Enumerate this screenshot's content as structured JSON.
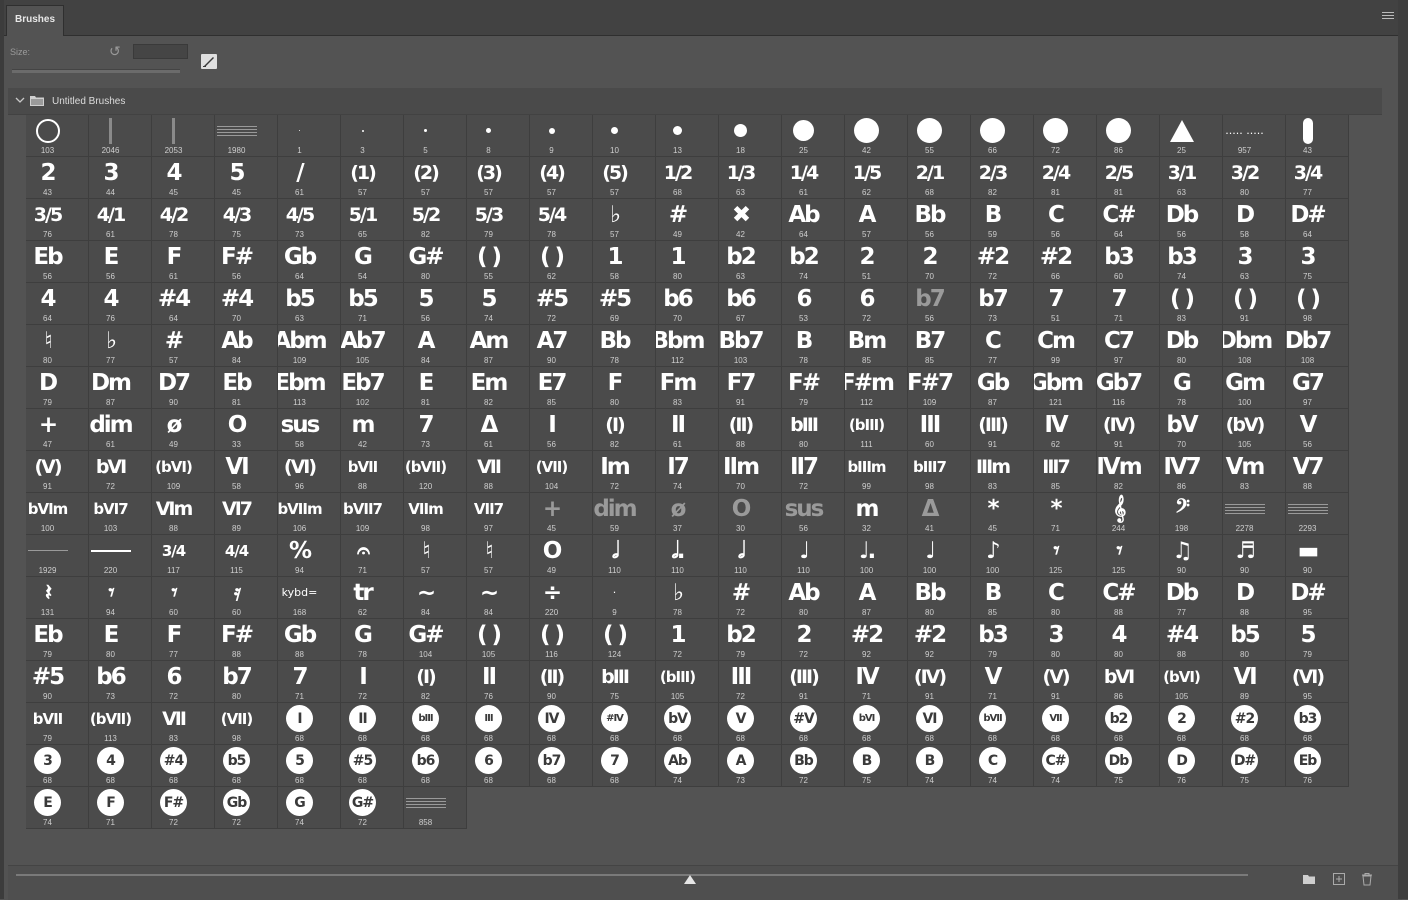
{
  "panel": {
    "tab_label": "Brushes",
    "size_label": "Size:",
    "size_value": "",
    "group_name": "Untitled Brushes"
  },
  "icons": {
    "panel_menu": "hamburger-menu-icon",
    "reset": "reset-icon",
    "brush_settings": "brush-settings-icon",
    "chevron": "chevron-down-icon",
    "folder": "folder-icon",
    "new_group": "folder-icon",
    "new_brush": "add-icon",
    "delete": "trash-icon"
  },
  "brushes": [
    {
      "g": "",
      "n": "103",
      "k": "ring"
    },
    {
      "g": "",
      "n": "2046",
      "k": "line"
    },
    {
      "g": "",
      "n": "2053",
      "k": "line"
    },
    {
      "g": "",
      "n": "1980",
      "k": "hatch"
    },
    {
      "g": "",
      "n": "1",
      "k": "dot1"
    },
    {
      "g": "",
      "n": "3",
      "k": "dot2"
    },
    {
      "g": "",
      "n": "5",
      "k": "dot3"
    },
    {
      "g": "",
      "n": "8",
      "k": "dot4"
    },
    {
      "g": "",
      "n": "9",
      "k": "dot5"
    },
    {
      "g": "",
      "n": "10",
      "k": "dot6"
    },
    {
      "g": "",
      "n": "13",
      "k": "dot7"
    },
    {
      "g": "",
      "n": "18",
      "k": "dot8"
    },
    {
      "g": "",
      "n": "25",
      "k": "dot9"
    },
    {
      "g": "",
      "n": "42",
      "k": "dot10"
    },
    {
      "g": "",
      "n": "55",
      "k": "dot10"
    },
    {
      "g": "",
      "n": "66",
      "k": "dot10"
    },
    {
      "g": "",
      "n": "72",
      "k": "dot10"
    },
    {
      "g": "",
      "n": "86",
      "k": "dot10"
    },
    {
      "g": "",
      "n": "25",
      "k": "tri"
    },
    {
      "g": "..... .....",
      "n": "957",
      "k": "tiny"
    },
    {
      "g": "",
      "n": "43",
      "k": "pill"
    },
    {
      "g": "2",
      "n": "43"
    },
    {
      "g": "3",
      "n": "44"
    },
    {
      "g": "4",
      "n": "45"
    },
    {
      "g": "5",
      "n": "45"
    },
    {
      "g": "/",
      "n": "61"
    },
    {
      "g": "(1)",
      "n": "57",
      "k": "med"
    },
    {
      "g": "(2)",
      "n": "57",
      "k": "med"
    },
    {
      "g": "(3)",
      "n": "57",
      "k": "med"
    },
    {
      "g": "(4)",
      "n": "57",
      "k": "med"
    },
    {
      "g": "(5)",
      "n": "57",
      "k": "med"
    },
    {
      "g": "1/2",
      "n": "68",
      "k": "med"
    },
    {
      "g": "1/3",
      "n": "63",
      "k": "med"
    },
    {
      "g": "1/4",
      "n": "61",
      "k": "med"
    },
    {
      "g": "1/5",
      "n": "62",
      "k": "med"
    },
    {
      "g": "2/1",
      "n": "68",
      "k": "med"
    },
    {
      "g": "2/3",
      "n": "82",
      "k": "med"
    },
    {
      "g": "2/4",
      "n": "81",
      "k": "med"
    },
    {
      "g": "2/5",
      "n": "81",
      "k": "med"
    },
    {
      "g": "3/1",
      "n": "63",
      "k": "med"
    },
    {
      "g": "3/2",
      "n": "80",
      "k": "med"
    },
    {
      "g": "3/4",
      "n": "77",
      "k": "med"
    },
    {
      "g": "3/5",
      "n": "76",
      "k": "med"
    },
    {
      "g": "4/1",
      "n": "61",
      "k": "med"
    },
    {
      "g": "4/2",
      "n": "78",
      "k": "med"
    },
    {
      "g": "4/3",
      "n": "75",
      "k": "med"
    },
    {
      "g": "4/5",
      "n": "73",
      "k": "med"
    },
    {
      "g": "5/1",
      "n": "65",
      "k": "med"
    },
    {
      "g": "5/2",
      "n": "82",
      "k": "med"
    },
    {
      "g": "5/3",
      "n": "79",
      "k": "med"
    },
    {
      "g": "5/4",
      "n": "78",
      "k": "med"
    },
    {
      "g": "♭",
      "n": "57"
    },
    {
      "g": "#",
      "n": "49"
    },
    {
      "g": "✖",
      "n": "42"
    },
    {
      "g": "Ab",
      "n": "64"
    },
    {
      "g": "A",
      "n": "57"
    },
    {
      "g": "Bb",
      "n": "56"
    },
    {
      "g": "B",
      "n": "59"
    },
    {
      "g": "C",
      "n": "56"
    },
    {
      "g": "C#",
      "n": "64"
    },
    {
      "g": "Db",
      "n": "56"
    },
    {
      "g": "D",
      "n": "58"
    },
    {
      "g": "D#",
      "n": "64"
    },
    {
      "g": "Eb",
      "n": "56"
    },
    {
      "g": "E",
      "n": "56"
    },
    {
      "g": "F",
      "n": "61"
    },
    {
      "g": "F#",
      "n": "56"
    },
    {
      "g": "Gb",
      "n": "64"
    },
    {
      "g": "G",
      "n": "54"
    },
    {
      "g": "G#",
      "n": "80"
    },
    {
      "g": "( )",
      "n": "55"
    },
    {
      "g": "( )",
      "n": "62"
    },
    {
      "g": "1",
      "n": "58"
    },
    {
      "g": "1",
      "n": "80"
    },
    {
      "g": "b2",
      "n": "63"
    },
    {
      "g": "b2",
      "n": "74"
    },
    {
      "g": "2",
      "n": "51"
    },
    {
      "g": "2",
      "n": "70"
    },
    {
      "g": "#2",
      "n": "72"
    },
    {
      "g": "#2",
      "n": "66"
    },
    {
      "g": "b3",
      "n": "60"
    },
    {
      "g": "b3",
      "n": "74"
    },
    {
      "g": "3",
      "n": "63"
    },
    {
      "g": "3",
      "n": "75"
    },
    {
      "g": "4",
      "n": "64"
    },
    {
      "g": "4",
      "n": "76"
    },
    {
      "g": "#4",
      "n": "64"
    },
    {
      "g": "#4",
      "n": "70"
    },
    {
      "g": "b5",
      "n": "63"
    },
    {
      "g": "b5",
      "n": "71"
    },
    {
      "g": "5",
      "n": "56"
    },
    {
      "g": "5",
      "n": "74"
    },
    {
      "g": "#5",
      "n": "72"
    },
    {
      "g": "#5",
      "n": "69"
    },
    {
      "g": "b6",
      "n": "70"
    },
    {
      "g": "b6",
      "n": "67"
    },
    {
      "g": "6",
      "n": "53"
    },
    {
      "g": "6",
      "n": "72"
    },
    {
      "g": "b7",
      "n": "56",
      "k": "gray"
    },
    {
      "g": "b7",
      "n": "73"
    },
    {
      "g": "7",
      "n": "51"
    },
    {
      "g": "7",
      "n": "71"
    },
    {
      "g": "( )",
      "n": "83"
    },
    {
      "g": "( )",
      "n": "91"
    },
    {
      "g": "( )",
      "n": "98"
    },
    {
      "g": "♮",
      "n": "80"
    },
    {
      "g": "♭",
      "n": "77"
    },
    {
      "g": "#",
      "n": "57"
    },
    {
      "g": "Ab",
      "n": "84"
    },
    {
      "g": "Abm",
      "n": "109"
    },
    {
      "g": "Ab7",
      "n": "105"
    },
    {
      "g": "A",
      "n": "84"
    },
    {
      "g": "Am",
      "n": "87"
    },
    {
      "g": "A7",
      "n": "90"
    },
    {
      "g": "Bb",
      "n": "78"
    },
    {
      "g": "Bbm",
      "n": "112"
    },
    {
      "g": "Bb7",
      "n": "103"
    },
    {
      "g": "B",
      "n": "78"
    },
    {
      "g": "Bm",
      "n": "85"
    },
    {
      "g": "B7",
      "n": "85"
    },
    {
      "g": "C",
      "n": "77"
    },
    {
      "g": "Cm",
      "n": "99"
    },
    {
      "g": "C7",
      "n": "97"
    },
    {
      "g": "Db",
      "n": "80"
    },
    {
      "g": "Dbm",
      "n": "108"
    },
    {
      "g": "Db7",
      "n": "108"
    },
    {
      "g": "D",
      "n": "79"
    },
    {
      "g": "Dm",
      "n": "87"
    },
    {
      "g": "D7",
      "n": "90"
    },
    {
      "g": "Eb",
      "n": "81"
    },
    {
      "g": "Ebm",
      "n": "113"
    },
    {
      "g": "Eb7",
      "n": "102"
    },
    {
      "g": "E",
      "n": "81"
    },
    {
      "g": "Em",
      "n": "82"
    },
    {
      "g": "E7",
      "n": "85"
    },
    {
      "g": "F",
      "n": "80"
    },
    {
      "g": "Fm",
      "n": "83"
    },
    {
      "g": "F7",
      "n": "91"
    },
    {
      "g": "F#",
      "n": "79"
    },
    {
      "g": "F#m",
      "n": "112"
    },
    {
      "g": "F#7",
      "n": "109"
    },
    {
      "g": "Gb",
      "n": "87"
    },
    {
      "g": "Gbm",
      "n": "121"
    },
    {
      "g": "Gb7",
      "n": "116"
    },
    {
      "g": "G",
      "n": "78"
    },
    {
      "g": "Gm",
      "n": "100"
    },
    {
      "g": "G7",
      "n": "97"
    },
    {
      "g": "+",
      "n": "47"
    },
    {
      "g": "dim",
      "n": "61"
    },
    {
      "g": "ø",
      "n": "49"
    },
    {
      "g": "O",
      "n": "33"
    },
    {
      "g": "sus",
      "n": "58"
    },
    {
      "g": "m",
      "n": "42"
    },
    {
      "g": "7",
      "n": "73"
    },
    {
      "g": "Δ",
      "n": "61"
    },
    {
      "g": "I",
      "n": "56"
    },
    {
      "g": "(I)",
      "n": "82",
      "k": "med"
    },
    {
      "g": "II",
      "n": "61"
    },
    {
      "g": "(II)",
      "n": "88",
      "k": "med"
    },
    {
      "g": "bIII",
      "n": "80",
      "k": "med"
    },
    {
      "g": "(bIII)",
      "n": "111",
      "k": "small"
    },
    {
      "g": "III",
      "n": "60"
    },
    {
      "g": "(III)",
      "n": "91",
      "k": "med"
    },
    {
      "g": "IV",
      "n": "62"
    },
    {
      "g": "(IV)",
      "n": "91",
      "k": "med"
    },
    {
      "g": "bV",
      "n": "70"
    },
    {
      "g": "(bV)",
      "n": "105",
      "k": "med"
    },
    {
      "g": "V",
      "n": "56"
    },
    {
      "g": "(V)",
      "n": "91",
      "k": "med"
    },
    {
      "g": "bVI",
      "n": "72",
      "k": "med"
    },
    {
      "g": "(bVI)",
      "n": "109",
      "k": "small"
    },
    {
      "g": "VI",
      "n": "58"
    },
    {
      "g": "(VI)",
      "n": "96",
      "k": "med"
    },
    {
      "g": "bVII",
      "n": "88",
      "k": "small"
    },
    {
      "g": "(bVII)",
      "n": "120",
      "k": "small"
    },
    {
      "g": "VII",
      "n": "88",
      "k": "med"
    },
    {
      "g": "(VII)",
      "n": "104",
      "k": "small"
    },
    {
      "g": "Im",
      "n": "72"
    },
    {
      "g": "I7",
      "n": "74"
    },
    {
      "g": "IIm",
      "n": "70"
    },
    {
      "g": "II7",
      "n": "72"
    },
    {
      "g": "bIIIm",
      "n": "99",
      "k": "small"
    },
    {
      "g": "bIII7",
      "n": "98",
      "k": "small"
    },
    {
      "g": "IIIm",
      "n": "83",
      "k": "med"
    },
    {
      "g": "III7",
      "n": "85",
      "k": "med"
    },
    {
      "g": "IVm",
      "n": "82"
    },
    {
      "g": "IV7",
      "n": "86"
    },
    {
      "g": "Vm",
      "n": "83"
    },
    {
      "g": "V7",
      "n": "88"
    },
    {
      "g": "bVIm",
      "n": "100",
      "k": "small"
    },
    {
      "g": "bVI7",
      "n": "103",
      "k": "small"
    },
    {
      "g": "VIm",
      "n": "88",
      "k": "med"
    },
    {
      "g": "VI7",
      "n": "89",
      "k": "med"
    },
    {
      "g": "bVIIm",
      "n": "106",
      "k": "small"
    },
    {
      "g": "bVII7",
      "n": "109",
      "k": "small"
    },
    {
      "g": "VIIm",
      "n": "98",
      "k": "small"
    },
    {
      "g": "VII7",
      "n": "97",
      "k": "small"
    },
    {
      "g": "+",
      "n": "45",
      "k": "gray"
    },
    {
      "g": "dim",
      "n": "59",
      "k": "gray"
    },
    {
      "g": "ø",
      "n": "37",
      "k": "gray"
    },
    {
      "g": "O",
      "n": "30",
      "k": "gray"
    },
    {
      "g": "sus",
      "n": "56",
      "k": "gray"
    },
    {
      "g": "m",
      "n": "32"
    },
    {
      "g": "Δ",
      "n": "41",
      "k": "gray"
    },
    {
      "g": "*",
      "n": "45"
    },
    {
      "g": "*",
      "n": "71"
    },
    {
      "g": "𝄞",
      "n": "244"
    },
    {
      "g": "𝄢",
      "n": "198"
    },
    {
      "g": "",
      "n": "2278",
      "k": "hatch"
    },
    {
      "g": "",
      "n": "2293",
      "k": "hatch"
    },
    {
      "g": "",
      "n": "1929",
      "k": "line"
    },
    {
      "g": "",
      "n": "220",
      "k": "line"
    },
    {
      "g": "3/4",
      "n": "117",
      "k": "small"
    },
    {
      "g": "4/4",
      "n": "115",
      "k": "small"
    },
    {
      "g": "%",
      "n": "94"
    },
    {
      "g": "𝄐",
      "n": "71"
    },
    {
      "g": "♮",
      "n": "57"
    },
    {
      "g": "♮",
      "n": "57"
    },
    {
      "g": "O",
      "n": "49"
    },
    {
      "g": "𝅗𝅥",
      "n": "110"
    },
    {
      "g": "𝅗𝅥.",
      "n": "110"
    },
    {
      "g": "𝅗𝅥",
      "n": "110"
    },
    {
      "g": "♩",
      "n": "110"
    },
    {
      "g": "♩.",
      "n": "100"
    },
    {
      "g": "♩",
      "n": "100"
    },
    {
      "g": "♪",
      "n": "100"
    },
    {
      "g": "𝄾",
      "n": "125"
    },
    {
      "g": "𝄾",
      "n": "125"
    },
    {
      "g": "♫",
      "n": "90"
    },
    {
      "g": "♬",
      "n": "90"
    },
    {
      "g": "▬",
      "n": "90"
    },
    {
      "g": "𝄽",
      "n": "131"
    },
    {
      "g": "𝄾",
      "n": "94"
    },
    {
      "g": "𝄾",
      "n": "60"
    },
    {
      "g": "𝄿",
      "n": "60"
    },
    {
      "g": "kybd=",
      "n": "168",
      "k": "tiny"
    },
    {
      "g": "tr",
      "n": "62"
    },
    {
      "g": "~",
      "n": "84"
    },
    {
      "g": "~",
      "n": "84"
    },
    {
      "g": "÷",
      "n": "220"
    },
    {
      "g": "·",
      "n": "9",
      "k": "tiny"
    },
    {
      "g": "♭",
      "n": "78"
    },
    {
      "g": "#",
      "n": "72"
    },
    {
      "g": "Ab",
      "n": "80"
    },
    {
      "g": "A",
      "n": "87"
    },
    {
      "g": "Bb",
      "n": "80"
    },
    {
      "g": "B",
      "n": "85"
    },
    {
      "g": "C",
      "n": "80"
    },
    {
      "g": "C#",
      "n": "88"
    },
    {
      "g": "Db",
      "n": "77"
    },
    {
      "g": "D",
      "n": "88"
    },
    {
      "g": "D#",
      "n": "95"
    },
    {
      "g": "Eb",
      "n": "79"
    },
    {
      "g": "E",
      "n": "80"
    },
    {
      "g": "F",
      "n": "77"
    },
    {
      "g": "F#",
      "n": "88"
    },
    {
      "g": "Gb",
      "n": "88"
    },
    {
      "g": "G",
      "n": "78"
    },
    {
      "g": "G#",
      "n": "104"
    },
    {
      "g": "( )",
      "n": "105"
    },
    {
      "g": "( )",
      "n": "116"
    },
    {
      "g": "( )",
      "n": "124"
    },
    {
      "g": "1",
      "n": "72"
    },
    {
      "g": "b2",
      "n": "79"
    },
    {
      "g": "2",
      "n": "72"
    },
    {
      "g": "#2",
      "n": "92"
    },
    {
      "g": "#2",
      "n": "92"
    },
    {
      "g": "b3",
      "n": "79"
    },
    {
      "g": "3",
      "n": "80"
    },
    {
      "g": "4",
      "n": "80"
    },
    {
      "g": "#4",
      "n": "88"
    },
    {
      "g": "b5",
      "n": "80"
    },
    {
      "g": "5",
      "n": "79"
    },
    {
      "g": "#5",
      "n": "90"
    },
    {
      "g": "b6",
      "n": "73"
    },
    {
      "g": "6",
      "n": "72"
    },
    {
      "g": "b7",
      "n": "80"
    },
    {
      "g": "7",
      "n": "71"
    },
    {
      "g": "I",
      "n": "72"
    },
    {
      "g": "(I)",
      "n": "82",
      "k": "med"
    },
    {
      "g": "II",
      "n": "76"
    },
    {
      "g": "(II)",
      "n": "90",
      "k": "med"
    },
    {
      "g": "bIII",
      "n": "75",
      "k": "med"
    },
    {
      "g": "(bIII)",
      "n": "105",
      "k": "small"
    },
    {
      "g": "III",
      "n": "72"
    },
    {
      "g": "(III)",
      "n": "91",
      "k": "med"
    },
    {
      "g": "IV",
      "n": "71"
    },
    {
      "g": "(IV)",
      "n": "91",
      "k": "med"
    },
    {
      "g": "V",
      "n": "71"
    },
    {
      "g": "(V)",
      "n": "91",
      "k": "med"
    },
    {
      "g": "bVI",
      "n": "86",
      "k": "med"
    },
    {
      "g": "(bVI)",
      "n": "105",
      "k": "small"
    },
    {
      "g": "VI",
      "n": "89"
    },
    {
      "g": "(VI)",
      "n": "95",
      "k": "med"
    },
    {
      "g": "bVII",
      "n": "79",
      "k": "small"
    },
    {
      "g": "(bVII)",
      "n": "113",
      "k": "small"
    },
    {
      "g": "VII",
      "n": "83",
      "k": "med"
    },
    {
      "g": "(VII)",
      "n": "98",
      "k": "small"
    },
    {
      "g": "I",
      "n": "68",
      "k": "circle"
    },
    {
      "g": "II",
      "n": "68",
      "k": "circle"
    },
    {
      "g": "bIII",
      "n": "68",
      "k": "circle s"
    },
    {
      "g": "III",
      "n": "68",
      "k": "circle s"
    },
    {
      "g": "IV",
      "n": "68",
      "k": "circle"
    },
    {
      "g": "#IV",
      "n": "68",
      "k": "circle s"
    },
    {
      "g": "bV",
      "n": "68",
      "k": "circle"
    },
    {
      "g": "V",
      "n": "68",
      "k": "circle"
    },
    {
      "g": "#V",
      "n": "68",
      "k": "circle"
    },
    {
      "g": "bVI",
      "n": "68",
      "k": "circle s"
    },
    {
      "g": "VI",
      "n": "68",
      "k": "circle"
    },
    {
      "g": "bVII",
      "n": "68",
      "k": "circle s"
    },
    {
      "g": "VII",
      "n": "68",
      "k": "circle s"
    },
    {
      "g": "b2",
      "n": "68",
      "k": "circle"
    },
    {
      "g": "2",
      "n": "68",
      "k": "circle"
    },
    {
      "g": "#2",
      "n": "68",
      "k": "circle"
    },
    {
      "g": "b3",
      "n": "68",
      "k": "circle"
    },
    {
      "g": "3",
      "n": "68",
      "k": "circle"
    },
    {
      "g": "4",
      "n": "68",
      "k": "circle"
    },
    {
      "g": "#4",
      "n": "68",
      "k": "circle"
    },
    {
      "g": "b5",
      "n": "68",
      "k": "circle"
    },
    {
      "g": "5",
      "n": "68",
      "k": "circle"
    },
    {
      "g": "#5",
      "n": "68",
      "k": "circle"
    },
    {
      "g": "b6",
      "n": "68",
      "k": "circle"
    },
    {
      "g": "6",
      "n": "68",
      "k": "circle"
    },
    {
      "g": "b7",
      "n": "68",
      "k": "circle"
    },
    {
      "g": "7",
      "n": "68",
      "k": "circle"
    },
    {
      "g": "Ab",
      "n": "74",
      "k": "circle"
    },
    {
      "g": "A",
      "n": "73",
      "k": "circle"
    },
    {
      "g": "Bb",
      "n": "72",
      "k": "circle"
    },
    {
      "g": "B",
      "n": "75",
      "k": "circle"
    },
    {
      "g": "B",
      "n": "74",
      "k": "circle"
    },
    {
      "g": "C",
      "n": "74",
      "k": "circle"
    },
    {
      "g": "C#",
      "n": "74",
      "k": "circle"
    },
    {
      "g": "Db",
      "n": "75",
      "k": "circle"
    },
    {
      "g": "D",
      "n": "76",
      "k": "circle"
    },
    {
      "g": "D#",
      "n": "75",
      "k": "circle"
    },
    {
      "g": "Eb",
      "n": "76",
      "k": "circle"
    },
    {
      "g": "E",
      "n": "74",
      "k": "circle"
    },
    {
      "g": "F",
      "n": "71",
      "k": "circle"
    },
    {
      "g": "F#",
      "n": "72",
      "k": "circle"
    },
    {
      "g": "Gb",
      "n": "72",
      "k": "circle"
    },
    {
      "g": "G",
      "n": "74",
      "k": "circle"
    },
    {
      "g": "G#",
      "n": "72",
      "k": "circle"
    },
    {
      "g": "",
      "n": "858",
      "k": "hatch"
    }
  ]
}
